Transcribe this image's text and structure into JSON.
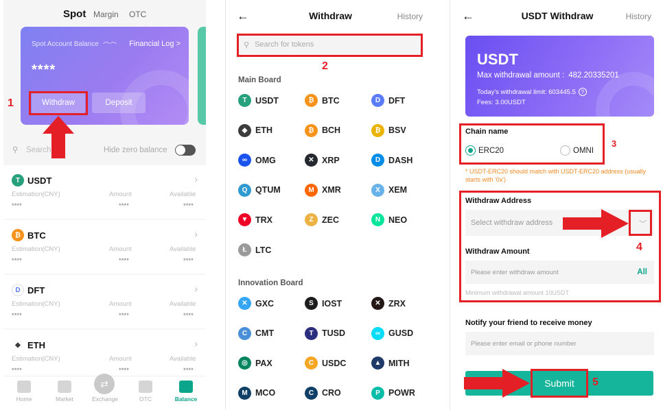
{
  "spot_screen": {
    "tabs": [
      "Spot",
      "Margin",
      "OTC"
    ],
    "card": {
      "balance_label": "Spot Account Balance",
      "financial_log": "Financial Log >",
      "balance_masked": "****",
      "withdraw_label": "Withdraw",
      "deposit_label": "Deposit"
    },
    "search_placeholder": "Search",
    "hide_zero": "Hide zero balance",
    "asset_labels": {
      "estimation": "Estimation(CNY)",
      "amount": "Amount",
      "available": "Available"
    },
    "assets": [
      {
        "name": "USDT",
        "estimation": "****",
        "amount": "****",
        "available": "****",
        "icon": "usdt-icon",
        "color": "#26a17b"
      },
      {
        "name": "BTC",
        "estimation": "****",
        "amount": "****",
        "available": "****",
        "icon": "btc-icon",
        "color": "#f7931a"
      },
      {
        "name": "DFT",
        "estimation": "****",
        "amount": "****",
        "available": "****",
        "icon": "dft-icon",
        "color": "#5b7cfa"
      },
      {
        "name": "ETH",
        "estimation": "****",
        "amount": "****",
        "available": "****",
        "icon": "eth-icon",
        "color": "#3c3c3d"
      }
    ],
    "nav": [
      "Home",
      "Market",
      "Exchange",
      "OTC",
      "Balance"
    ]
  },
  "withdraw_screen": {
    "title": "Withdraw",
    "history": "History",
    "search_placeholder": "Search for tokens",
    "main_board_title": "Main Board",
    "main_board": [
      {
        "symbol": "USDT",
        "color": "#26a17b",
        "glyph": "T"
      },
      {
        "symbol": "BTC",
        "color": "#f7931a",
        "glyph": "₿"
      },
      {
        "symbol": "DFT",
        "color": "#5b7cfa",
        "glyph": "D"
      },
      {
        "symbol": "ETH",
        "color": "#3c3c3d",
        "glyph": "◆"
      },
      {
        "symbol": "BCH",
        "color": "#f7931a",
        "glyph": "₿"
      },
      {
        "symbol": "BSV",
        "color": "#eab300",
        "glyph": "₿"
      },
      {
        "symbol": "OMG",
        "color": "#1a53f0",
        "glyph": "∞"
      },
      {
        "symbol": "XRP",
        "color": "#23292f",
        "glyph": "✕"
      },
      {
        "symbol": "DASH",
        "color": "#008ce7",
        "glyph": "D"
      },
      {
        "symbol": "QTUM",
        "color": "#2e9ad0",
        "glyph": "Q"
      },
      {
        "symbol": "XMR",
        "color": "#ff6600",
        "glyph": "M"
      },
      {
        "symbol": "XEM",
        "color": "#67b2e8",
        "glyph": "X"
      },
      {
        "symbol": "TRX",
        "color": "#ef0027",
        "glyph": "▼"
      },
      {
        "symbol": "ZEC",
        "color": "#ecb244",
        "glyph": "Z"
      },
      {
        "symbol": "NEO",
        "color": "#00e599",
        "glyph": "N"
      },
      {
        "symbol": "LTC",
        "color": "#9a9a9a",
        "glyph": "Ł"
      }
    ],
    "innovation_board_title": "Innovation Board",
    "innovation_board": [
      {
        "symbol": "GXC",
        "color": "#35a5f5",
        "glyph": "✕"
      },
      {
        "symbol": "IOST",
        "color": "#1c1c1c",
        "glyph": "S"
      },
      {
        "symbol": "ZRX",
        "color": "#231815",
        "glyph": "✕"
      },
      {
        "symbol": "CMT",
        "color": "#4a90d9",
        "glyph": "C"
      },
      {
        "symbol": "TUSD",
        "color": "#2b2e7f",
        "glyph": "T"
      },
      {
        "symbol": "GUSD",
        "color": "#00dcfa",
        "glyph": "∞"
      },
      {
        "symbol": "PAX",
        "color": "#00845d",
        "glyph": "◎"
      },
      {
        "symbol": "USDC",
        "color": "#f5a623",
        "glyph": "C"
      },
      {
        "symbol": "MITH",
        "color": "#1f3a68",
        "glyph": "▲"
      },
      {
        "symbol": "MCO",
        "color": "#103f68",
        "glyph": "M"
      },
      {
        "symbol": "CRO",
        "color": "#103f68",
        "glyph": "C"
      },
      {
        "symbol": "POWR",
        "color": "#05bca9",
        "glyph": "P"
      }
    ]
  },
  "usdt_screen": {
    "title": "USDT Withdraw",
    "history": "History",
    "card": {
      "token": "USDT",
      "max_label": "Max withdrawal amount :",
      "max_value": "482.20335201",
      "limit": "Today's withdrawal limit: 603445.5",
      "fees": "Fees: 3.00USDT"
    },
    "chain_label": "Chain name",
    "chains": [
      {
        "name": "ERC20",
        "selected": true
      },
      {
        "name": "OMNI",
        "selected": false
      }
    ],
    "warning": "* USDT-ERC20 should match with USDT-ERC20 address (usually starts with '0x')",
    "address_label": "Withdraw Address",
    "address_placeholder": "Select withdraw address",
    "amount_label": "Withdraw Amount",
    "amount_placeholder": "Please enter withdraw amount",
    "all_label": "All",
    "min_note": "Minimum withdrawal amount 10USDT",
    "notify_label": "Notify your friend to receive money",
    "notify_placeholder": "Please enter email or phone number",
    "submit_label": "Submit"
  },
  "annotations": [
    "1",
    "2",
    "3",
    "4",
    "5"
  ],
  "colors": {
    "accent": "#14b59a",
    "annotation": "#e41f26",
    "card_purple": "#8f6ff6"
  }
}
